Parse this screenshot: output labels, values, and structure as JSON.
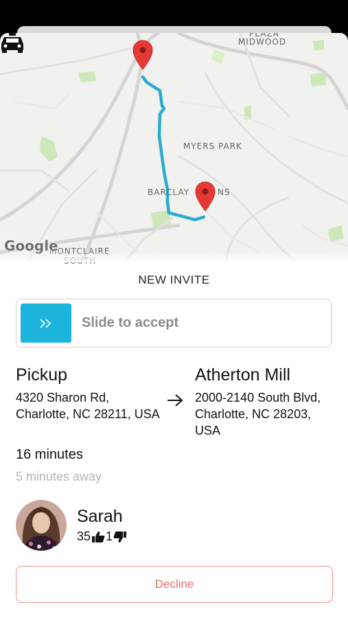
{
  "map": {
    "labels": {
      "midwood_top": "PLAZA",
      "midwood": "MIDWOOD",
      "myers_park": "MYERS PARK",
      "barclay_left": "BARCLAY",
      "barclay_right": "NS",
      "montclaire": "MONTCLAIRE",
      "montclaire_south": "SOUTH"
    },
    "attribution": "Google",
    "route_color": "#2aabcf",
    "pin_color": "#e53935"
  },
  "invite": {
    "title": "NEW INVITE",
    "slide_label": "Slide to accept",
    "accent": "#1cb3dc"
  },
  "pickup": {
    "title": "Pickup",
    "address": "4320 Sharon Rd, Charlotte, NC 28211, USA"
  },
  "dropoff": {
    "title": "Atherton Mill",
    "address": "2000-2140 South Blvd, Charlotte, NC 28203, USA"
  },
  "trip": {
    "duration": "16 minutes",
    "away": "5 minutes away"
  },
  "rider": {
    "name": "Sarah",
    "thumbs_up": "35",
    "thumbs_down": "1"
  },
  "actions": {
    "decline_label": "Decline",
    "decline_color": "#ea6c6c"
  }
}
